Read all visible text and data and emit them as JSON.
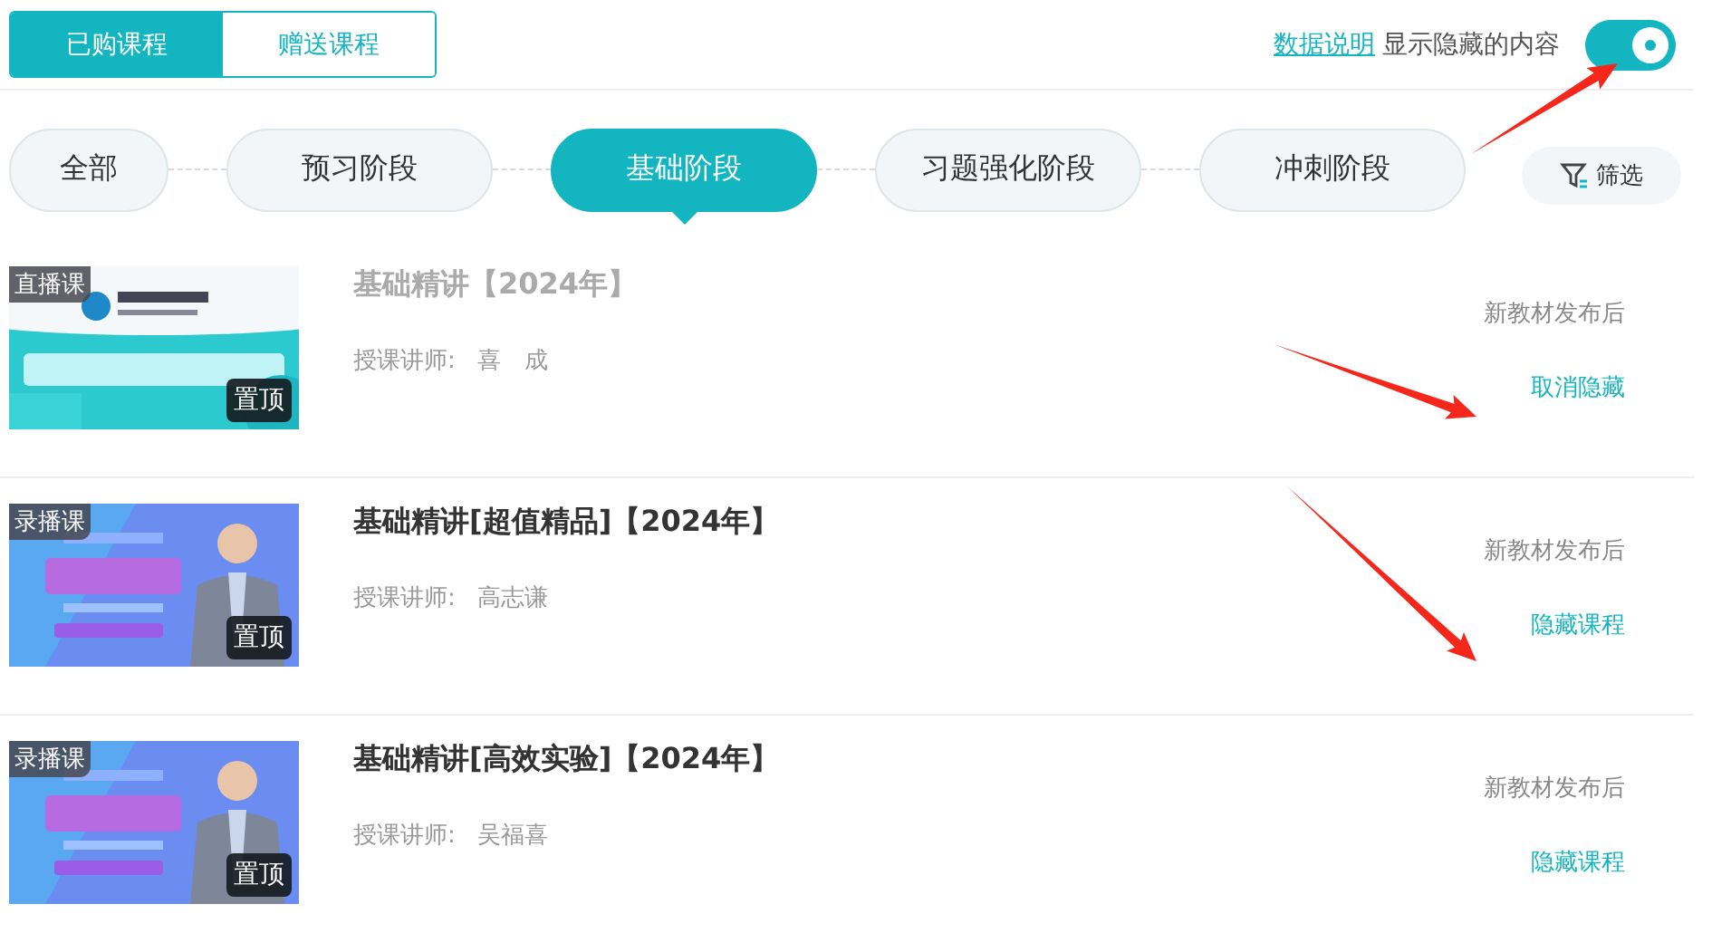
{
  "course_tabs": [
    {
      "label": "已购课程",
      "selected": true
    },
    {
      "label": "赠送课程",
      "selected": false
    }
  ],
  "data_link": "数据说明",
  "toggle": {
    "label": "显示隐藏的内容",
    "on": true
  },
  "stages": [
    {
      "label": "全部",
      "selected": false
    },
    {
      "label": "预习阶段",
      "selected": false
    },
    {
      "label": "基础阶段",
      "selected": true
    },
    {
      "label": "习题强化阶段",
      "selected": false
    },
    {
      "label": "冲刺阶段",
      "selected": false
    }
  ],
  "filter_button": "筛选",
  "courses": [
    {
      "badge": "直播课",
      "pin": "置顶",
      "title": "基础精讲【2024年】",
      "teacher_label": "授课讲师:",
      "teacher": "喜　成",
      "hidden": true,
      "status": "新教材发布后",
      "action": "取消隐藏"
    },
    {
      "badge": "录播课",
      "pin": "置顶",
      "title": "基础精讲[超值精品]【2024年】",
      "teacher_label": "授课讲师:",
      "teacher": "高志谦",
      "hidden": false,
      "status": "新教材发布后",
      "action": "隐藏课程"
    },
    {
      "badge": "录播课",
      "pin": "置顶",
      "title": "基础精讲[高效实验]【2024年】",
      "teacher_label": "授课讲师:",
      "teacher": "吴福喜",
      "hidden": false,
      "status": "新教材发布后",
      "action": "隐藏课程"
    }
  ]
}
